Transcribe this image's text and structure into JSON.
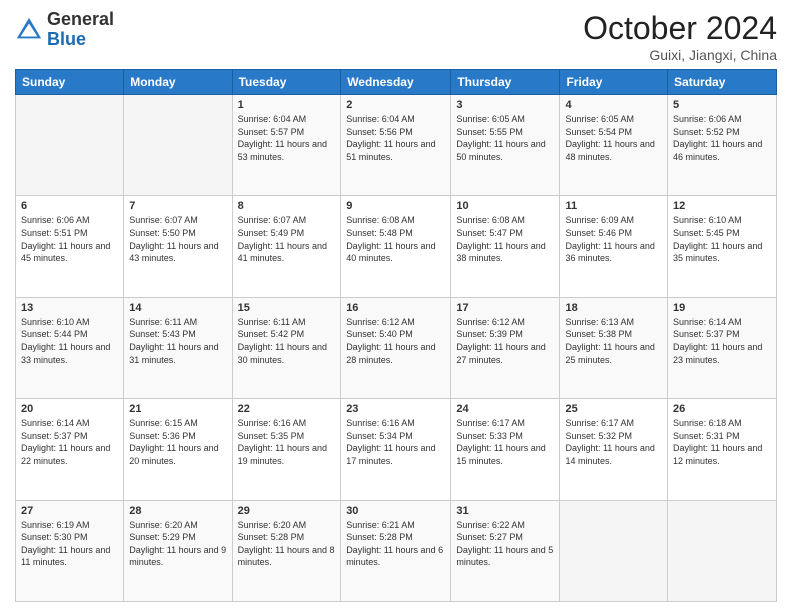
{
  "header": {
    "logo_general": "General",
    "logo_blue": "Blue",
    "month_title": "October 2024",
    "location": "Guixi, Jiangxi, China"
  },
  "weekdays": [
    "Sunday",
    "Monday",
    "Tuesday",
    "Wednesday",
    "Thursday",
    "Friday",
    "Saturday"
  ],
  "weeks": [
    [
      {
        "day": "",
        "sunrise": "",
        "sunset": "",
        "daylight": ""
      },
      {
        "day": "",
        "sunrise": "",
        "sunset": "",
        "daylight": ""
      },
      {
        "day": "1",
        "sunrise": "Sunrise: 6:04 AM",
        "sunset": "Sunset: 5:57 PM",
        "daylight": "Daylight: 11 hours and 53 minutes."
      },
      {
        "day": "2",
        "sunrise": "Sunrise: 6:04 AM",
        "sunset": "Sunset: 5:56 PM",
        "daylight": "Daylight: 11 hours and 51 minutes."
      },
      {
        "day": "3",
        "sunrise": "Sunrise: 6:05 AM",
        "sunset": "Sunset: 5:55 PM",
        "daylight": "Daylight: 11 hours and 50 minutes."
      },
      {
        "day": "4",
        "sunrise": "Sunrise: 6:05 AM",
        "sunset": "Sunset: 5:54 PM",
        "daylight": "Daylight: 11 hours and 48 minutes."
      },
      {
        "day": "5",
        "sunrise": "Sunrise: 6:06 AM",
        "sunset": "Sunset: 5:52 PM",
        "daylight": "Daylight: 11 hours and 46 minutes."
      }
    ],
    [
      {
        "day": "6",
        "sunrise": "Sunrise: 6:06 AM",
        "sunset": "Sunset: 5:51 PM",
        "daylight": "Daylight: 11 hours and 45 minutes."
      },
      {
        "day": "7",
        "sunrise": "Sunrise: 6:07 AM",
        "sunset": "Sunset: 5:50 PM",
        "daylight": "Daylight: 11 hours and 43 minutes."
      },
      {
        "day": "8",
        "sunrise": "Sunrise: 6:07 AM",
        "sunset": "Sunset: 5:49 PM",
        "daylight": "Daylight: 11 hours and 41 minutes."
      },
      {
        "day": "9",
        "sunrise": "Sunrise: 6:08 AM",
        "sunset": "Sunset: 5:48 PM",
        "daylight": "Daylight: 11 hours and 40 minutes."
      },
      {
        "day": "10",
        "sunrise": "Sunrise: 6:08 AM",
        "sunset": "Sunset: 5:47 PM",
        "daylight": "Daylight: 11 hours and 38 minutes."
      },
      {
        "day": "11",
        "sunrise": "Sunrise: 6:09 AM",
        "sunset": "Sunset: 5:46 PM",
        "daylight": "Daylight: 11 hours and 36 minutes."
      },
      {
        "day": "12",
        "sunrise": "Sunrise: 6:10 AM",
        "sunset": "Sunset: 5:45 PM",
        "daylight": "Daylight: 11 hours and 35 minutes."
      }
    ],
    [
      {
        "day": "13",
        "sunrise": "Sunrise: 6:10 AM",
        "sunset": "Sunset: 5:44 PM",
        "daylight": "Daylight: 11 hours and 33 minutes."
      },
      {
        "day": "14",
        "sunrise": "Sunrise: 6:11 AM",
        "sunset": "Sunset: 5:43 PM",
        "daylight": "Daylight: 11 hours and 31 minutes."
      },
      {
        "day": "15",
        "sunrise": "Sunrise: 6:11 AM",
        "sunset": "Sunset: 5:42 PM",
        "daylight": "Daylight: 11 hours and 30 minutes."
      },
      {
        "day": "16",
        "sunrise": "Sunrise: 6:12 AM",
        "sunset": "Sunset: 5:40 PM",
        "daylight": "Daylight: 11 hours and 28 minutes."
      },
      {
        "day": "17",
        "sunrise": "Sunrise: 6:12 AM",
        "sunset": "Sunset: 5:39 PM",
        "daylight": "Daylight: 11 hours and 27 minutes."
      },
      {
        "day": "18",
        "sunrise": "Sunrise: 6:13 AM",
        "sunset": "Sunset: 5:38 PM",
        "daylight": "Daylight: 11 hours and 25 minutes."
      },
      {
        "day": "19",
        "sunrise": "Sunrise: 6:14 AM",
        "sunset": "Sunset: 5:37 PM",
        "daylight": "Daylight: 11 hours and 23 minutes."
      }
    ],
    [
      {
        "day": "20",
        "sunrise": "Sunrise: 6:14 AM",
        "sunset": "Sunset: 5:37 PM",
        "daylight": "Daylight: 11 hours and 22 minutes."
      },
      {
        "day": "21",
        "sunrise": "Sunrise: 6:15 AM",
        "sunset": "Sunset: 5:36 PM",
        "daylight": "Daylight: 11 hours and 20 minutes."
      },
      {
        "day": "22",
        "sunrise": "Sunrise: 6:16 AM",
        "sunset": "Sunset: 5:35 PM",
        "daylight": "Daylight: 11 hours and 19 minutes."
      },
      {
        "day": "23",
        "sunrise": "Sunrise: 6:16 AM",
        "sunset": "Sunset: 5:34 PM",
        "daylight": "Daylight: 11 hours and 17 minutes."
      },
      {
        "day": "24",
        "sunrise": "Sunrise: 6:17 AM",
        "sunset": "Sunset: 5:33 PM",
        "daylight": "Daylight: 11 hours and 15 minutes."
      },
      {
        "day": "25",
        "sunrise": "Sunrise: 6:17 AM",
        "sunset": "Sunset: 5:32 PM",
        "daylight": "Daylight: 11 hours and 14 minutes."
      },
      {
        "day": "26",
        "sunrise": "Sunrise: 6:18 AM",
        "sunset": "Sunset: 5:31 PM",
        "daylight": "Daylight: 11 hours and 12 minutes."
      }
    ],
    [
      {
        "day": "27",
        "sunrise": "Sunrise: 6:19 AM",
        "sunset": "Sunset: 5:30 PM",
        "daylight": "Daylight: 11 hours and 11 minutes."
      },
      {
        "day": "28",
        "sunrise": "Sunrise: 6:20 AM",
        "sunset": "Sunset: 5:29 PM",
        "daylight": "Daylight: 11 hours and 9 minutes."
      },
      {
        "day": "29",
        "sunrise": "Sunrise: 6:20 AM",
        "sunset": "Sunset: 5:28 PM",
        "daylight": "Daylight: 11 hours and 8 minutes."
      },
      {
        "day": "30",
        "sunrise": "Sunrise: 6:21 AM",
        "sunset": "Sunset: 5:28 PM",
        "daylight": "Daylight: 11 hours and 6 minutes."
      },
      {
        "day": "31",
        "sunrise": "Sunrise: 6:22 AM",
        "sunset": "Sunset: 5:27 PM",
        "daylight": "Daylight: 11 hours and 5 minutes."
      },
      {
        "day": "",
        "sunrise": "",
        "sunset": "",
        "daylight": ""
      },
      {
        "day": "",
        "sunrise": "",
        "sunset": "",
        "daylight": ""
      }
    ]
  ]
}
